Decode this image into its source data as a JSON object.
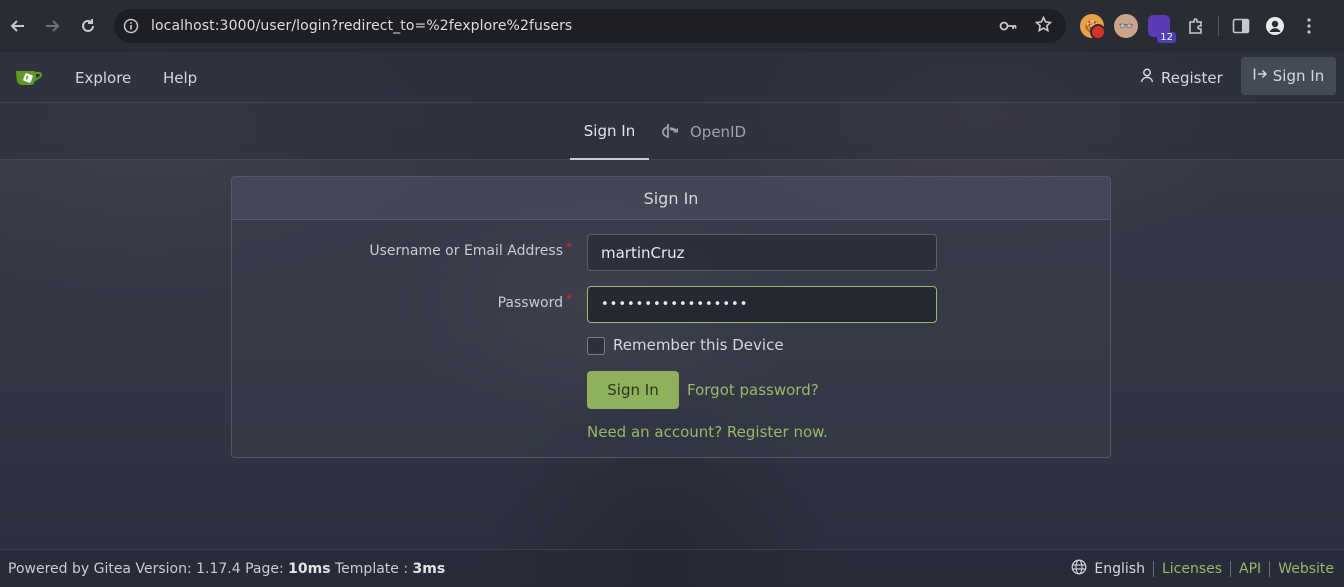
{
  "browser": {
    "url": "localhost:3000/user/login?redirect_to=%2fexplore%2fusers",
    "ext_badge": "12"
  },
  "nav": {
    "explore": "Explore",
    "help": "Help",
    "register": "Register",
    "sign_in": "Sign In"
  },
  "tabs": {
    "sign_in": "Sign In",
    "openid": "OpenID"
  },
  "form": {
    "title": "Sign In",
    "username_label": "Username or Email Address",
    "username_value": "martinCruz",
    "password_label": "Password",
    "password_value": "•••••••••••••••••",
    "remember_label": "Remember this Device",
    "submit_label": "Sign In",
    "forgot_label": "Forgot password?",
    "register_link": "Need an account? Register now.",
    "required_mark": "*"
  },
  "footer": {
    "powered_prefix": "Powered by Gitea Version: 1.17.4 Page: ",
    "page_time": "10ms",
    "template_prefix": " Template : ",
    "template_time": "3ms",
    "language": "English",
    "licenses": "Licenses",
    "api": "API",
    "website": "Website"
  },
  "colors": {
    "accent": "#9ab86a",
    "primary_button": "#8fb15c",
    "required": "#db2828"
  }
}
